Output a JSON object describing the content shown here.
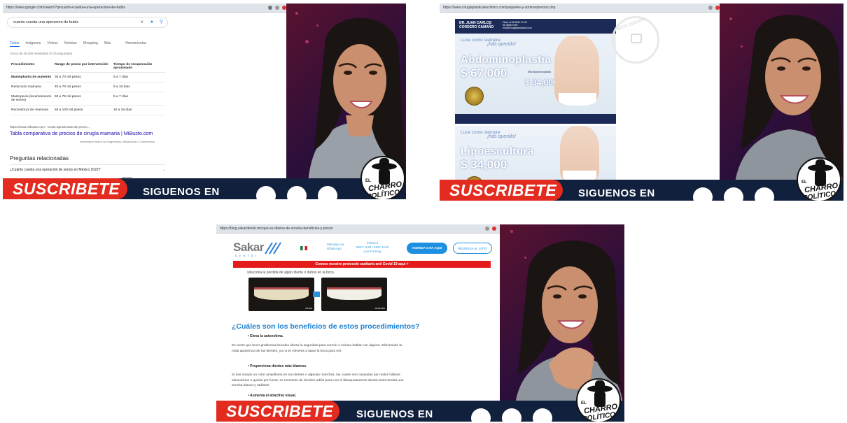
{
  "common": {
    "subscribe": "SUSCRIBETE",
    "follow": "SIGUENOS EN",
    "logo_el": "EL",
    "logo_line1": "CHARRO",
    "logo_line2": "POLÍTICO"
  },
  "frame1": {
    "url": "https://www.google.com/search?q=cuanto+cuesta+una+operacion+de+bubis",
    "search_query": "cuanto cuesta una operacion de bubis",
    "tabs": [
      "Todos",
      "Imágenes",
      "Vídeos",
      "Noticias",
      "Shopping",
      "Más",
      "Herramientas"
    ],
    "stats": "Cerca de 48,400 resultados (0.75 segundos)",
    "table_headers": [
      "Procedimiento",
      "Rango de precio por intervención",
      "Tiempo de recuperación aproximado"
    ],
    "table_rows": [
      [
        "Mamoplastia de aumento",
        "35 a 70 mil pesos",
        "5 a 7 días"
      ],
      [
        "Reducción mamaria",
        "40 a 70 mil pesos",
        "5 a 10 días"
      ],
      [
        "Mastopexia (levantamiento de senos)",
        "50 a 75 mil pesos",
        "5 a 7 días"
      ],
      [
        "Reconstrucción mamaria",
        "50 a 100 mil pesos",
        "10 a 15 días"
      ]
    ],
    "source": "https://www.mibusto.com › Costo-aproximado-de-precio...",
    "result_title": "Tabla comparativa de precios de cirugía mamaria | MiBusto.com",
    "feedback": "Información sobre los fragmentos destacados  •  Comentarios",
    "related_title": "Preguntas relacionadas",
    "related_q1": "¿Cuánto cuesta una operación de senos en México 2022?",
    "related_q2": "2022?"
  },
  "frame2": {
    "url": "https://www.cirugiaplasticaeuclinico.com/paquetes-y-sorteos/precios.php",
    "doctor": "DR. JUAN CARLOS\nCORDERO CAMAÑO",
    "contact": "Citas al 55 3840 70 04\n55 3865 0750\ninfo@cirugiaplasticadf.com",
    "luce": "Luce como siempre",
    "quedo": "¡has querido!",
    "proc1": "Abdominoplastia",
    "price1": "$ 67,000",
    "mini_label": "Mini Abdominoplastia",
    "price1b": "$ 34,000",
    "proc2": "Lipoescultura",
    "price2": "$ 34,000",
    "seal_text": "SITIO SEGURO"
  },
  "frame3": {
    "url": "https://blog.sakardental.mx/que-es-diseno-de-sonrisa-beneficios-y-precio",
    "logo": "Sakar",
    "logo_sub": "DENTAL",
    "whatsapp": "Mensaje vía\nWhatsApp",
    "polanco": "Polanco\n5557-1138 / 5557-1145\nLuis Furtong",
    "cita_button": "AGENDA CITA AQUÍ",
    "sitio_button": "REGRESA AL SITIO",
    "covid": "Conoce nuestro protocolo sanitario anti Covid 19 aquí >",
    "intro": "soluciona la pérdida de algún diente o daños en la boca.",
    "caption_before": "ANTES",
    "caption_after": "DESPUÉS",
    "heading": "¿Cuáles son los beneficios de estos procedimientos?",
    "benefit1": "Eleva la autoestima.",
    "para1": "Es cierto que tener problemas bucales afecta la seguridad para sonreír o incluso hablar con alguien. Eliminando la mala apariencia de tus dientes, ya no te volverás a tapar la boca para reír.",
    "benefit2": "Proporciona dientes más blancos.",
    "para2": "Si has notado un color amarillento en tus dientes o algunas manchas, las cuales son causadas por malos hábitos alimenticios o quizás por fumar, es momento de decirles adiós pues con el blanqueamiento dental usted tendrá una sonrisa blanca y radiante.",
    "benefit3": "Aumenta el atractivo visual."
  },
  "colors": {
    "subscribe_red": "#e32b1f",
    "banner_navy": "#10203d",
    "google_link": "#1a0dab",
    "sakar_blue": "#1d7fd0",
    "covid_red": "#e41b1b"
  }
}
